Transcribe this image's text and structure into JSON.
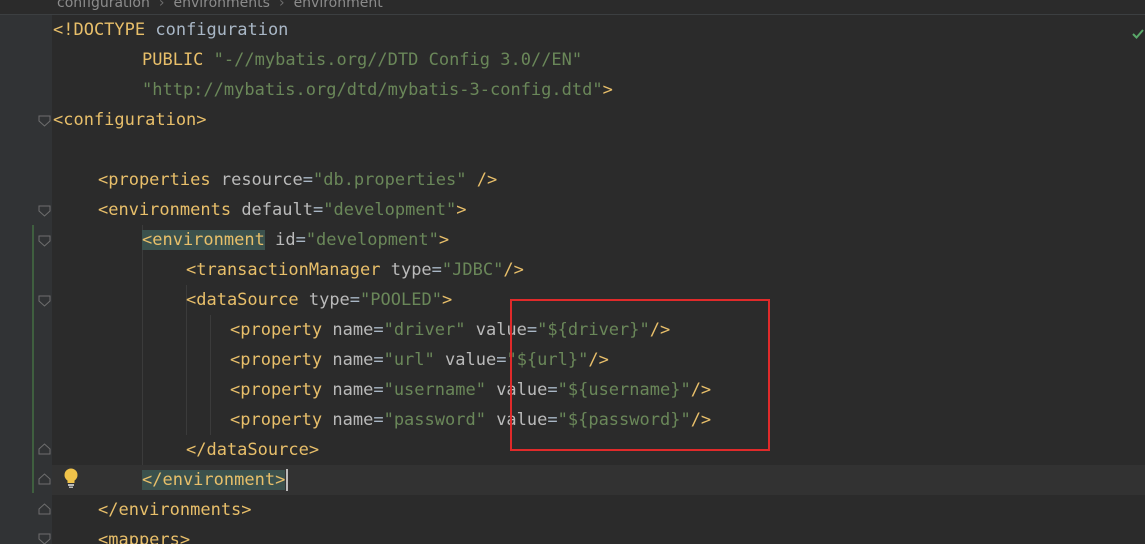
{
  "breadcrumb": {
    "items": [
      "configuration",
      "environments",
      "environment"
    ],
    "separator": "›"
  },
  "code": {
    "doctype_open": "<!DOCTYPE",
    "doctype_name": " configuration",
    "public_kw": "PUBLIC",
    "public_id": "\"-//mybatis.org//DTD Config 3.0//EN\"",
    "system_id": "\"http://mybatis.org/dtd/mybatis-3-config.dtd\"",
    "doctype_close": ">",
    "configuration_open": "<configuration>",
    "properties_tag": "<properties",
    "properties_attr": "resource",
    "properties_eq": "=",
    "properties_val": "\"db.properties\"",
    "properties_close": " />",
    "environments_tag": "<environments",
    "environments_attr": "default",
    "environments_eq": "=",
    "environments_val": "\"development\"",
    "environments_close": ">",
    "environment_tag": "<environment",
    "environment_attr": "id",
    "environment_eq": "=",
    "environment_val": "\"development\"",
    "environment_close": ">",
    "tx_tag": "<transactionManager",
    "tx_attr": "type",
    "tx_eq": "=",
    "tx_val": "\"JDBC\"",
    "tx_close": "/>",
    "ds_tag": "<dataSource",
    "ds_attr": "type",
    "ds_eq": "=",
    "ds_val": "\"POOLED\"",
    "ds_close": ">",
    "prop_tag": "<property",
    "name_attr": "name",
    "value_attr": "value",
    "eq": "=",
    "selfclose": "/>",
    "properties": [
      {
        "name": "\"driver\"",
        "value": "\"${driver}\""
      },
      {
        "name": "\"url\"",
        "value": "\"${url}\""
      },
      {
        "name": "\"username\"",
        "value": "\"${username}\""
      },
      {
        "name": "\"password\"",
        "value": "\"${password}\""
      }
    ],
    "ds_end": "</dataSource>",
    "environment_end_tag": "</environment",
    "environment_end_close": ">",
    "environments_end": "</environments>",
    "mappers_open": "<mappers>"
  },
  "colors": {
    "background": "#2b2b2b",
    "tag": "#e8bf6a",
    "attribute": "#bababa",
    "string": "#6a8759",
    "keyword": "#cc7832",
    "annotation_box": "#e02a2a"
  },
  "icons": [
    "fold-marker-icon",
    "lightbulb-icon",
    "inspection-ok-icon"
  ]
}
